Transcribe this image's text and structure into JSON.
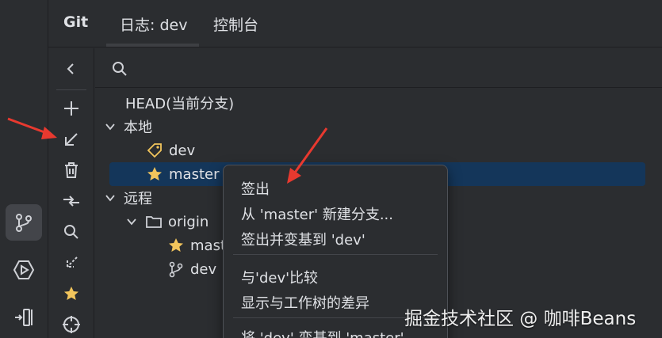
{
  "header": {
    "title": "Git",
    "tabs": [
      {
        "label": "日志: dev"
      },
      {
        "label": "控制台"
      }
    ]
  },
  "search": {
    "placeholder": ""
  },
  "tree": {
    "head": "HEAD(当前分支)",
    "local_label": "本地",
    "local_branches": [
      "dev",
      "master"
    ],
    "remote_label": "远程",
    "remote_group": "origin",
    "remote_branches": [
      "master",
      "dev"
    ]
  },
  "context_menu": {
    "items": [
      "签出",
      "从 'master' 新建分支...",
      "签出并变基到 'dev'",
      "与'dev'比较",
      "显示与工作树的差异",
      "将 'dev' 变基到 'master'"
    ]
  },
  "watermark": "掘金技术社区 @ 咖啡Beans",
  "colors": {
    "background": "#2b2d30",
    "selection": "#14365a",
    "text": "#dfe1e5",
    "star": "#f2c55c",
    "annotation_arrow": "#e8392f"
  },
  "icons": {
    "stripe": [
      "git-branch-icon",
      "services-icon",
      "structure-icon"
    ],
    "actions": [
      "collapse-icon",
      "add-icon",
      "update-arrow-icon",
      "delete-icon",
      "compare-icon",
      "search-icon",
      "fetch-icon",
      "star-icon",
      "target-icon"
    ]
  }
}
